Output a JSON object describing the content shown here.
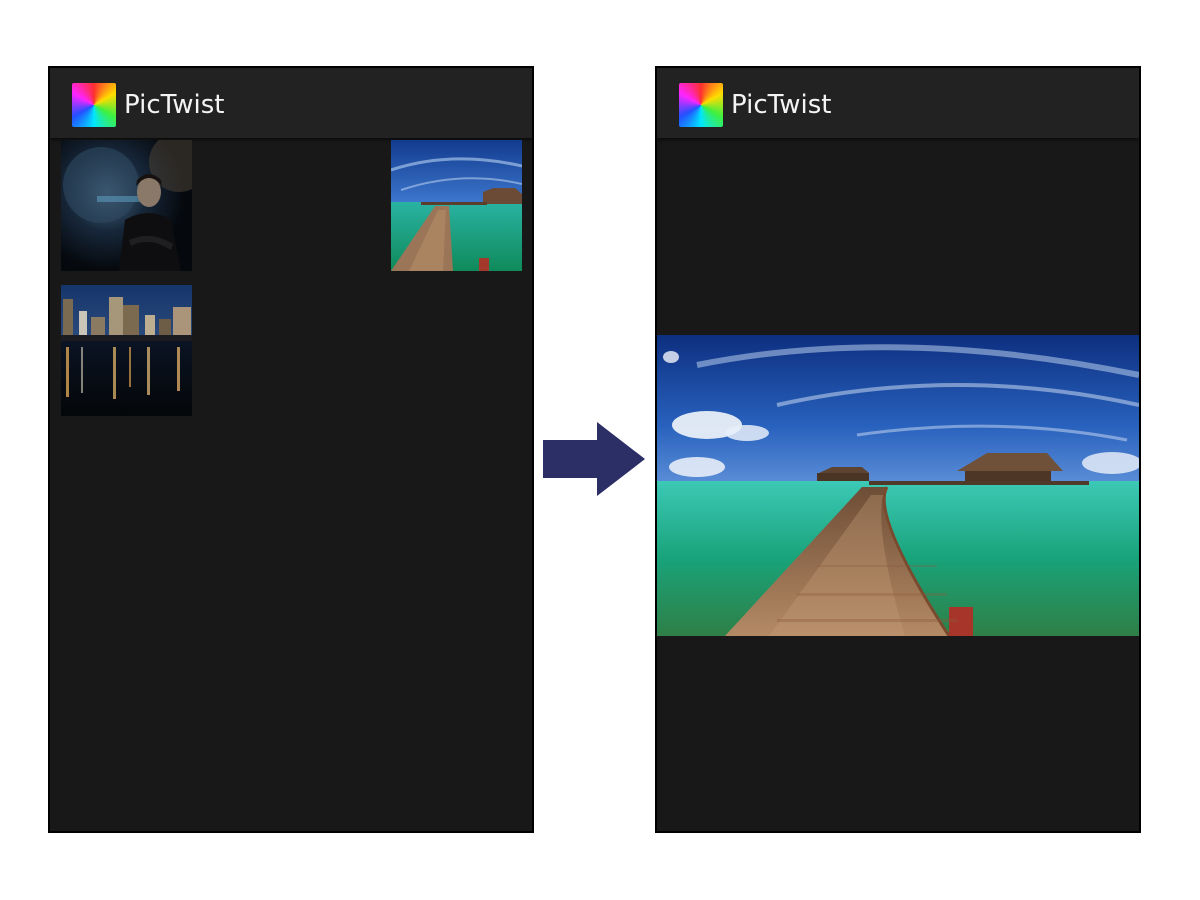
{
  "screens": {
    "before": {
      "app_title": "PicTwist",
      "app_icon": "swirl-icon",
      "gallery": [
        {
          "name": "portrait-photo"
        },
        {
          "name": "beach-boardwalk-photo"
        },
        {
          "name": "city-night-photo"
        }
      ]
    },
    "after": {
      "app_title": "PicTwist",
      "app_icon": "swirl-icon",
      "selected_image": "beach-boardwalk-photo"
    }
  },
  "transition_icon": "right-arrow-icon",
  "colors": {
    "screen_background": "#181818",
    "app_bar": "#222222",
    "title_text": "#f4f4f4",
    "arrow": "#2b2f66"
  }
}
